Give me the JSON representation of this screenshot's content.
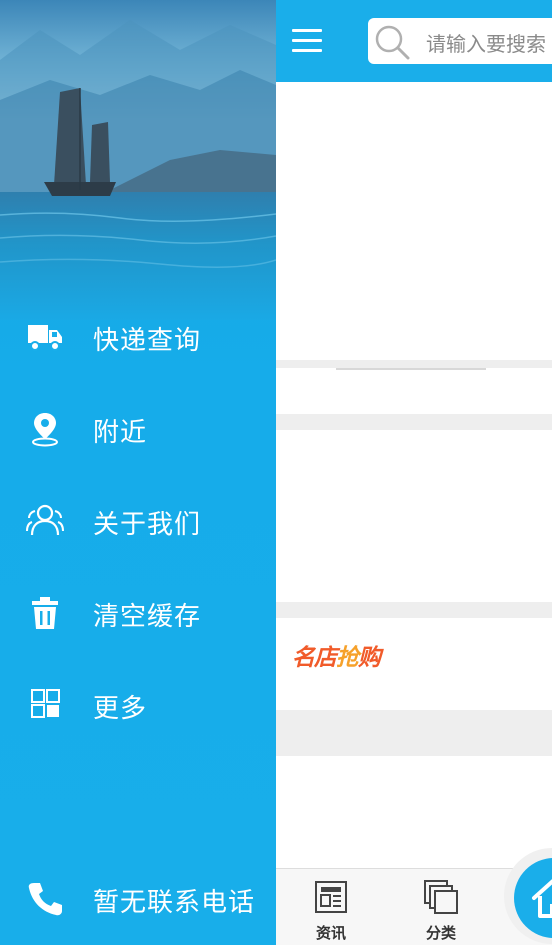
{
  "header": {
    "menu_icon": "hamburger-menu-icon",
    "search": {
      "icon": "search-icon",
      "placeholder": "请输入要搜索"
    }
  },
  "promo": {
    "part1": "名店",
    "part2": "抢",
    "part3": "购"
  },
  "tabbar": {
    "items": [
      {
        "label": "资讯",
        "icon": "news-icon"
      },
      {
        "label": "分类",
        "icon": "category-icon"
      }
    ],
    "home_icon": "home-icon"
  },
  "drawer": {
    "items": [
      {
        "label": "快递查询",
        "icon": "truck-icon"
      },
      {
        "label": "附近",
        "icon": "location-pin-icon"
      },
      {
        "label": "关于我们",
        "icon": "users-icon"
      },
      {
        "label": "清空缓存",
        "icon": "trash-icon"
      },
      {
        "label": "更多",
        "icon": "grid-icon"
      }
    ],
    "contact": {
      "label": "暂无联系电话",
      "icon": "phone-icon"
    }
  },
  "colors": {
    "primary": "#1aaeea",
    "promo_red": "#f15b2a",
    "promo_orange": "#f6a12a",
    "divider": "#eeeeee"
  }
}
